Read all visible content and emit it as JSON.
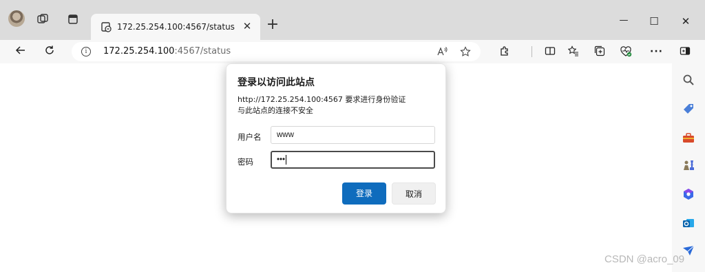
{
  "browser": {
    "tab": {
      "title": "172.25.254.100:4567/status",
      "close_glyph": "✕"
    },
    "new_tab_glyph": "+",
    "window_controls": {
      "minimize": "—",
      "maximize": "☐",
      "close": "✕"
    },
    "address_bar": {
      "url_host": "172.25.254.100",
      "url_path": ":4567/status"
    },
    "accent": "#0f6cbd"
  },
  "dialog": {
    "title": "登录以访问此站点",
    "message_line1": "http://172.25.254.100:4567 要求进行身份验证",
    "message_line2": "与此站点的连接不安全",
    "username": {
      "label": "用户名",
      "value": "www"
    },
    "password": {
      "label": "密码",
      "masked_value": "•••"
    },
    "login_button": "登录",
    "cancel_button": "取消"
  },
  "sidebar_icons": [
    "search-icon",
    "tag-icon",
    "toolbox-icon",
    "chess-icon",
    "copilot-icon",
    "outlook-icon",
    "send-icon"
  ],
  "watermark": "CSDN @acro_09"
}
